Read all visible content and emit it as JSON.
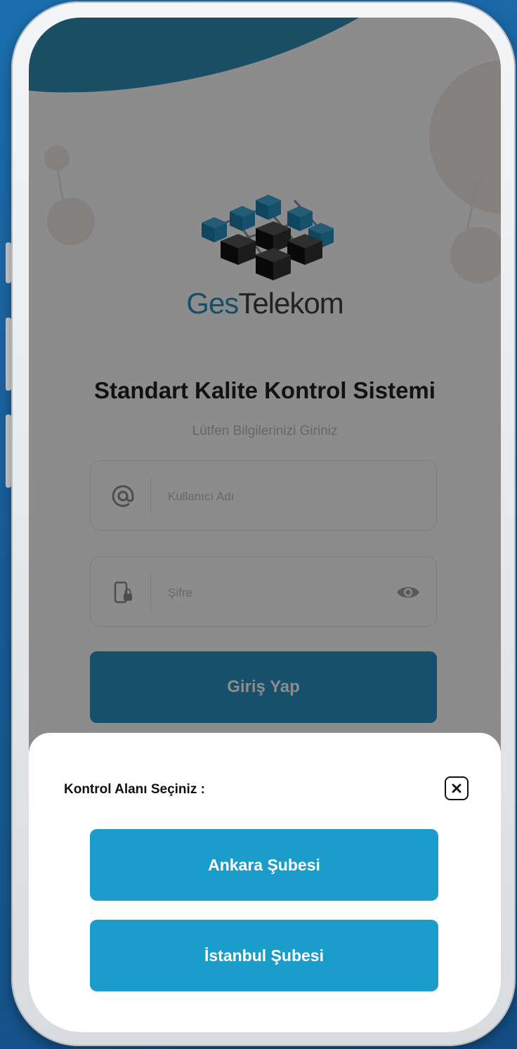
{
  "app": {
    "brand_part1": "Ges",
    "brand_part2": "Telekom",
    "title": "Standart Kalite Kontrol Sistemi",
    "subtitle": "Lütfen Bilgilerinizi Giriniz"
  },
  "form": {
    "username_placeholder": "Kullanıcı Adı",
    "username_value": "",
    "username_icon": "at-icon",
    "password_placeholder": "Şifre",
    "password_value": "",
    "password_icon": "phone-lock-icon",
    "password_toggle_icon": "eye-icon",
    "login_label": "Giriş Yap"
  },
  "sheet": {
    "title": "Kontrol Alanı Seçiniz :",
    "close_icon": "close-icon",
    "options": [
      {
        "label": "Ankara Şubesi"
      },
      {
        "label": "İstanbul Şubesi"
      }
    ]
  },
  "colors": {
    "accent": "#1b9dcb",
    "login_button": "#2a93c2",
    "brand_blue": "#2a8fc5",
    "background": "#1a5f9b"
  }
}
